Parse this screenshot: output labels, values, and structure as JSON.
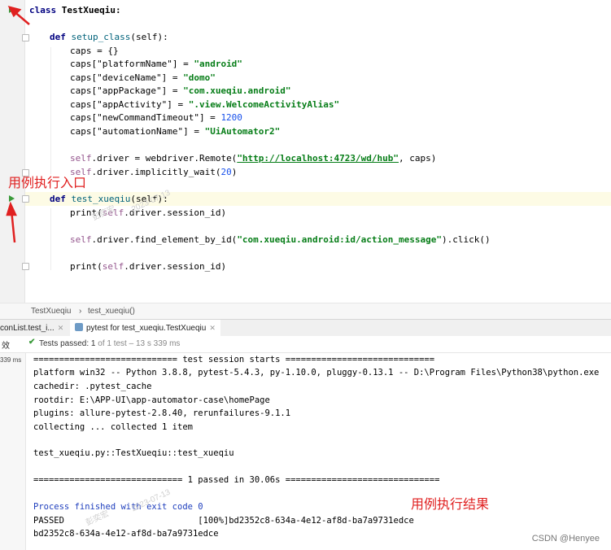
{
  "editor": {
    "lines": {
      "class_kw": "class",
      "class_name": " TestXueqiu:",
      "def1_kw": "def",
      "def1_name": " setup_class",
      "def1_args": "(self):",
      "caps_init": "caps = {}",
      "caps1_key": "caps[\"platformName\"] = ",
      "caps1_val": "\"android\"",
      "caps2_key": "caps[\"deviceName\"] = ",
      "caps2_val": "\"domo\"",
      "caps3_key": "caps[\"appPackage\"] = ",
      "caps3_val": "\"com.xueqiu.android\"",
      "caps4_key": "caps[\"appActivity\"] = ",
      "caps4_val": "\".view.WelcomeActivityAlias\"",
      "caps5_key": "caps[\"newCommandTimeout\"] = ",
      "caps5_val": "1200",
      "caps6_key": "caps[\"automationName\"] = ",
      "caps6_val": "\"UiAutomator2\"",
      "driver_self": "self",
      "driver_mid": ".driver = webdriver.Remote(",
      "driver_url": "\"http://localhost:4723/wd/hub\"",
      "driver_end": ", caps)",
      "wait_self": "self",
      "wait_mid": ".driver.implicitly_wait(",
      "wait_num": "20",
      "wait_end": ")",
      "def2_kw": "def",
      "def2_name": " test_xueqiu",
      "def2_args": "(self):",
      "print1_a": "print(",
      "print1_self": "self",
      "print1_b": ".driver.session_id)",
      "find_self": "self",
      "find_mid": ".driver.find_element_by_id(",
      "find_str": "\"com.xueqiu.android:id/action_message\"",
      "find_end": ").click()",
      "print2_a": "print(",
      "print2_self": "self",
      "print2_b": ".driver.session_id)"
    }
  },
  "breadcrumb": {
    "class": "TestXueqiu",
    "sep": "›",
    "method": "test_xueqiu()"
  },
  "run_tabs": [
    {
      "label": "conList.test_i..."
    },
    {
      "label": "pytest for test_xueqiu.TestXueqiu"
    }
  ],
  "status": {
    "gutter_char": "效",
    "passed_label": "Tests passed: 1",
    "passed_detail": " of 1 test – 13 s 339 ms",
    "time_badge": "339 ms"
  },
  "console": [
    "============================ test session starts =============================",
    "platform win32 -- Python 3.8.8, pytest-5.4.3, py-1.10.0, pluggy-0.13.1 -- D:\\Program Files\\Python38\\python.exe",
    "cachedir: .pytest_cache",
    "rootdir: E:\\APP-UI\\app-automator-case\\homePage",
    "plugins: allure-pytest-2.8.40, rerunfailures-9.1.1",
    "collecting ... collected 1 item",
    "test_xueqiu.py::TestXueqiu::test_xueqiu",
    "============================= 1 passed in 30.06s ==============================",
    "Process finished with exit code 0",
    "PASSED                          [100%]bd2352c8-634a-4e12-af8d-ba7a9731edce",
    "bd2352c8-634a-4e12-af8d-ba7a9731edce"
  ],
  "annotations": {
    "entry_label": "用例执行入口",
    "result_label": "用例执行结果"
  },
  "watermark": {
    "author": "彭奕宏",
    "date1": "2023-07-13",
    "date2": "2023-07-13"
  },
  "footer": {
    "csdn": "CSDN @Henyee"
  },
  "colors": {
    "annotation": "#e02020",
    "run_icon": "#3a9a3a",
    "keyword": "#000080",
    "string": "#067d17"
  }
}
